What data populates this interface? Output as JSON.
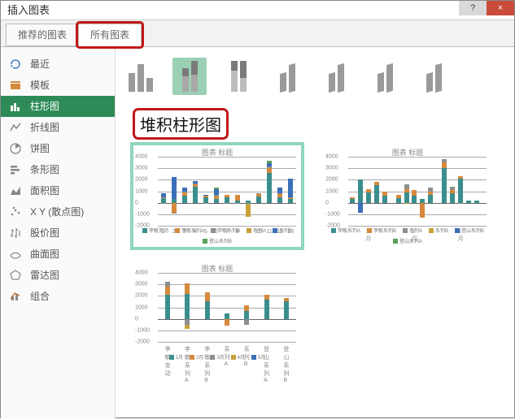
{
  "window": {
    "title": "插入图表",
    "help": "?",
    "close": "×"
  },
  "tabs": [
    {
      "label": "推荐的图表",
      "active": false
    },
    {
      "label": "所有图表",
      "active": true,
      "highlight": true
    }
  ],
  "sidebar": [
    {
      "icon": "recent-icon",
      "label": "最近",
      "sel": false
    },
    {
      "icon": "template-icon",
      "label": "模板",
      "sel": false
    },
    {
      "icon": "column-icon",
      "label": "柱形图",
      "sel": true
    },
    {
      "icon": "line-icon",
      "label": "折线图",
      "sel": false
    },
    {
      "icon": "pie-icon",
      "label": "饼图",
      "sel": false
    },
    {
      "icon": "bar-icon",
      "label": "条形图",
      "sel": false
    },
    {
      "icon": "area-icon",
      "label": "面积图",
      "sel": false
    },
    {
      "icon": "scatter-icon",
      "label": "X Y (散点图)",
      "sel": false
    },
    {
      "icon": "stock-icon",
      "label": "股价图",
      "sel": false
    },
    {
      "icon": "surface-icon",
      "label": "曲面图",
      "sel": false
    },
    {
      "icon": "radar-icon",
      "label": "雷达图",
      "sel": false
    },
    {
      "icon": "combo-icon",
      "label": "组合",
      "sel": false
    }
  ],
  "subtype_title": "堆积柱形图",
  "subtypes": [
    {
      "name": "clustered-column"
    },
    {
      "name": "stacked-column",
      "sel": true
    },
    {
      "name": "100pct-stacked-column"
    },
    {
      "name": "3d-clustered-column"
    },
    {
      "name": "3d-stacked-column"
    },
    {
      "name": "3d-100pct-stacked-column"
    },
    {
      "name": "3d-column"
    }
  ],
  "preview_titles": {
    "p1": "图表 标题",
    "p2": "图表 标题",
    "p3": "图表 标题"
  },
  "colors": {
    "teal": "#3b8e8e",
    "orange": "#d6893b",
    "gray": "#8e8e8e",
    "gold": "#c9a13b",
    "blue": "#3b6fb9",
    "green": "#5aa055"
  },
  "chart_data": [
    {
      "id": "p1",
      "type": "bar",
      "stacked": true,
      "title": "图表 标题",
      "ylim": [
        -2000,
        4000
      ],
      "yticks": [
        -2000,
        -1000,
        0,
        1000,
        2000,
        3000,
        4000
      ],
      "categories": [
        "1",
        "2",
        "3",
        "4",
        "5",
        "6",
        "7",
        "8",
        "9",
        "10",
        "11",
        "12",
        "13"
      ],
      "series": [
        {
          "name": "李敏变动",
          "color": "teal",
          "values": [
            400,
            350,
            600,
            1400,
            500,
            300,
            500,
            200,
            200,
            550,
            2600,
            500,
            300
          ]
        },
        {
          "name": "李敏系列A",
          "color": "orange",
          "values": [
            100,
            -900,
            300,
            200,
            100,
            250,
            200,
            500,
            -50,
            200,
            400,
            300,
            150
          ]
        },
        {
          "name": "李敏系列B",
          "color": "gray",
          "values": [
            -50,
            -50,
            100,
            100,
            -80,
            100,
            -50,
            -50,
            -50,
            100,
            150,
            50,
            50
          ]
        },
        {
          "name": "系列A",
          "color": "gold",
          "values": [
            0,
            0,
            0,
            0,
            0,
            0,
            0,
            0,
            -1100,
            0,
            0,
            0,
            0
          ]
        },
        {
          "name": "系列B",
          "color": "blue",
          "values": [
            300,
            1900,
            300,
            200,
            100,
            500,
            0,
            0,
            0,
            0,
            300,
            500,
            1600
          ]
        },
        {
          "name": "登山系列B",
          "color": "green",
          "values": [
            0,
            0,
            0,
            0,
            0,
            200,
            0,
            0,
            0,
            0,
            200,
            0,
            0
          ]
        }
      ]
    },
    {
      "id": "p2",
      "type": "bar",
      "stacked": true,
      "clustered_groups": true,
      "title": "图表 标题",
      "ylim": [
        -2000,
        4000
      ],
      "yticks": [
        -2000,
        -1000,
        0,
        1000,
        2000,
        3000,
        4000
      ],
      "categories": [
        "1月",
        "2月",
        "3月"
      ],
      "sub_categories_per_group": 5,
      "series": [
        {
          "name": "李敏系列A",
          "color": "teal"
        },
        {
          "name": "李敏系列B",
          "color": "orange"
        },
        {
          "name": "系列A",
          "color": "gray"
        },
        {
          "name": "系列B",
          "color": "gold"
        },
        {
          "name": "登山系列B",
          "color": "blue"
        },
        {
          "name": "登山系列A",
          "color": "green"
        }
      ],
      "group_values": [
        [
          [
            300,
            200,
            0,
            0,
            0,
            0
          ],
          [
            2000,
            0,
            0,
            0,
            -900,
            0
          ],
          [
            900,
            300,
            0,
            0,
            0,
            0
          ],
          [
            1500,
            300,
            0,
            0,
            0,
            0
          ],
          [
            600,
            400,
            0,
            0,
            0,
            0
          ]
        ],
        [
          [
            400,
            300,
            0,
            0,
            0,
            0
          ],
          [
            900,
            300,
            400,
            -100,
            0,
            0
          ],
          [
            600,
            500,
            0,
            0,
            0,
            0
          ],
          [
            300,
            -1300,
            0,
            0,
            0,
            0
          ],
          [
            700,
            300,
            300,
            0,
            0,
            0
          ]
        ],
        [
          [
            3000,
            500,
            300,
            0,
            0,
            0
          ],
          [
            800,
            300,
            300,
            0,
            0,
            0
          ],
          [
            2100,
            200,
            -100,
            0,
            0,
            0
          ],
          [
            200,
            0,
            0,
            0,
            0,
            0
          ],
          [
            200,
            0,
            0,
            0,
            0,
            0
          ]
        ]
      ]
    },
    {
      "id": "p3",
      "type": "bar",
      "stacked": true,
      "title": "图表 标题",
      "ylim": [
        -2000,
        4000
      ],
      "yticks": [
        -2000,
        -1000,
        0,
        1000,
        2000,
        3000,
        4000
      ],
      "categories": [
        "李敏变动",
        "李敏系列A",
        "李敏系列B",
        "系列A",
        "系列B",
        "登山系列A",
        "登山系列B"
      ],
      "series": [
        {
          "name": "1月",
          "color": "teal",
          "values": [
            2100,
            2200,
            1500,
            500,
            700,
            1700,
            1500
          ]
        },
        {
          "name": "2月",
          "color": "orange",
          "values": [
            700,
            900,
            800,
            -600,
            500,
            400,
            300
          ]
        },
        {
          "name": "3月",
          "color": "gray",
          "values": [
            400,
            -500,
            0,
            0,
            -500,
            0,
            0
          ]
        },
        {
          "name": "4月",
          "color": "gold",
          "values": [
            0,
            -400,
            0,
            0,
            0,
            0,
            0
          ]
        },
        {
          "name": "5月",
          "color": "blue",
          "values": [
            0,
            0,
            0,
            0,
            0,
            0,
            0
          ]
        }
      ]
    }
  ]
}
